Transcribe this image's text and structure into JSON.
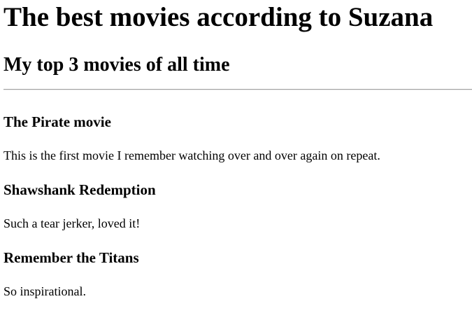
{
  "page_title": "The best movies according to Suzana",
  "subtitle": "My top 3 movies of all time",
  "movies": [
    {
      "title": "The Pirate movie",
      "description": "This is the first movie I remember watching over and over again on repeat."
    },
    {
      "title": "Shawshank Redemption",
      "description": "Such a tear jerker, loved it!"
    },
    {
      "title": "Remember the Titans",
      "description": "So inspirational."
    }
  ]
}
